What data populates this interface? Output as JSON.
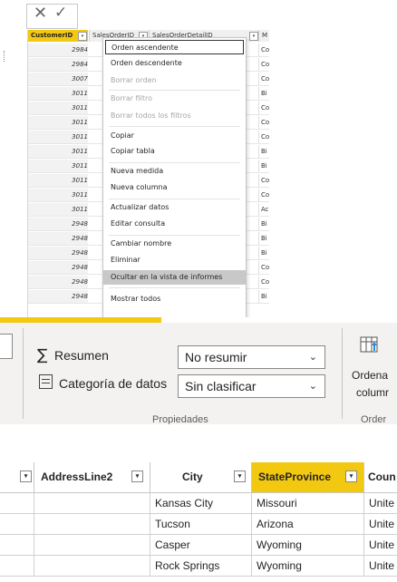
{
  "formula_bar": {
    "cancel_glyph": "✕",
    "commit_glyph": "✓"
  },
  "grid": {
    "columns": [
      "CustomerID",
      "SalesOrderID",
      "SalesOrderDetailID",
      "M"
    ],
    "rows": [
      {
        "cid": "2984",
        "m": "Co"
      },
      {
        "cid": "2984",
        "m": "Co"
      },
      {
        "cid": "3007",
        "m": "Co"
      },
      {
        "cid": "3011",
        "m": "Bi"
      },
      {
        "cid": "3011",
        "m": "Co"
      },
      {
        "cid": "3011",
        "m": "Co"
      },
      {
        "cid": "3011",
        "m": "Co"
      },
      {
        "cid": "3011",
        "m": "Bi"
      },
      {
        "cid": "3011",
        "m": "Bi"
      },
      {
        "cid": "3011",
        "m": "Co"
      },
      {
        "cid": "3011",
        "m": "Co"
      },
      {
        "cid": "3011",
        "m": "Ac"
      },
      {
        "cid": "2948",
        "m": "Bi"
      },
      {
        "cid": "2948",
        "m": "Bi"
      },
      {
        "cid": "2948",
        "m": "Bi"
      },
      {
        "cid": "2948",
        "m": "Co"
      },
      {
        "cid": "2948",
        "m": "Co"
      },
      {
        "cid": "2948",
        "m": "Bi"
      }
    ]
  },
  "context_menu": {
    "items": [
      {
        "label": "Orden ascendente",
        "state": "focused"
      },
      {
        "label": "Orden descendente",
        "state": "normal"
      },
      {
        "label": "Borrar orden",
        "state": "disabled"
      },
      {
        "label": "Borrar filtro",
        "state": "disabled"
      },
      {
        "label": "Borrar todos los filtros",
        "state": "disabled"
      },
      {
        "label": "Copiar",
        "state": "normal"
      },
      {
        "label": "Copiar tabla",
        "state": "normal"
      },
      {
        "label": "Nueva medida",
        "state": "normal"
      },
      {
        "label": "Nueva columna",
        "state": "normal"
      },
      {
        "label": "Actualizar datos",
        "state": "normal"
      },
      {
        "label": "Editar consulta",
        "state": "normal"
      },
      {
        "label": "Cambiar nombre",
        "state": "normal"
      },
      {
        "label": "Eliminar",
        "state": "normal"
      },
      {
        "label": "Ocultar en la vista de informes",
        "state": "highlighted"
      },
      {
        "label": "Mostrar todos",
        "state": "normal"
      }
    ]
  },
  "ribbon": {
    "summarization_label": "Resumen",
    "summarization_value": "No resumir",
    "category_label": "Categoría de datos",
    "category_value": "Sin clasificar",
    "group_label": "Propiedades",
    "sort_label_line1": "Ordena",
    "sort_label_line2": "columr",
    "sort_group_label": "Order",
    "accent": "#f2c811"
  },
  "table": {
    "headers": [
      "AddressLine2",
      "City",
      "StateProvince",
      "Coun"
    ],
    "rows": [
      {
        "address2": "",
        "city": "Kansas City",
        "state": "Missouri",
        "country": "Unite"
      },
      {
        "address2": "",
        "city": "Tucson",
        "state": "Arizona",
        "country": "Unite"
      },
      {
        "address2": "",
        "city": "Casper",
        "state": "Wyoming",
        "country": "Unite"
      },
      {
        "address2": "",
        "city": "Rock Springs",
        "state": "Wyoming",
        "country": "Unite"
      }
    ]
  }
}
